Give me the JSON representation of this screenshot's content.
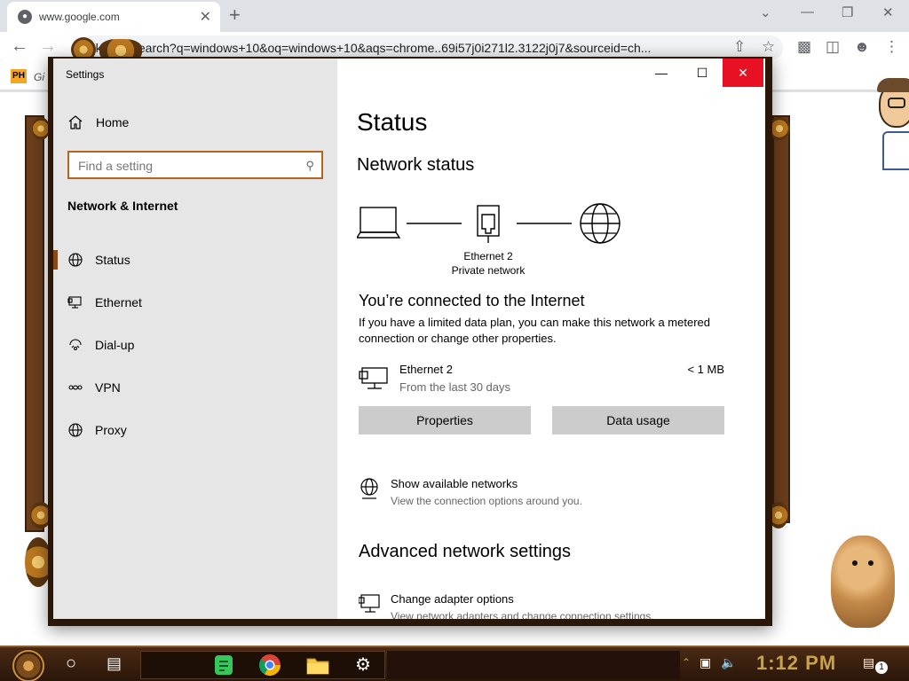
{
  "browser": {
    "tab_title": "www.google.com",
    "url": "...k.com/search?q=windows+10&oq=windows+10&aqs=chrome..69i57j0i271l2.3122j0j7&sourceid=ch...",
    "bookmark_badge": "PH",
    "bookmark_label": "Gi"
  },
  "settings": {
    "window_title": "Settings",
    "home_label": "Home",
    "search_placeholder": "Find a setting",
    "section_title": "Network & Internet",
    "nav": [
      {
        "label": "Status",
        "icon": "status-globe-icon",
        "selected": true
      },
      {
        "label": "Ethernet",
        "icon": "ethernet-icon",
        "selected": false
      },
      {
        "label": "Dial-up",
        "icon": "dial-up-icon",
        "selected": false
      },
      {
        "label": "VPN",
        "icon": "vpn-icon",
        "selected": false
      },
      {
        "label": "Proxy",
        "icon": "proxy-globe-icon",
        "selected": false
      }
    ],
    "page_title": "Status",
    "network_status_heading": "Network status",
    "diagram": {
      "adapter_name": "Ethernet 2",
      "network_type": "Private network"
    },
    "connected_title": "You’re connected to the Internet",
    "connected_desc": "If you have a limited data plan, you can make this network a metered connection or change other properties.",
    "connection": {
      "name": "Ethernet 2",
      "period": "From the last 30 days",
      "usage": "< 1 MB"
    },
    "properties_button": "Properties",
    "data_usage_button": "Data usage",
    "show_networks": {
      "title": "Show available networks",
      "subtitle": "View the connection options around you."
    },
    "advanced_heading": "Advanced network settings",
    "adapter_options": {
      "title": "Change adapter options",
      "subtitle": "View network adapters and change connection settings."
    }
  },
  "taskbar": {
    "clock": "1:12 PM",
    "notification_count": "1"
  },
  "colors": {
    "accent": "#8a4a16",
    "close_red": "#e81123",
    "sidebar_bg": "#e6e6e6",
    "button_gray": "#cccccc",
    "clock_gold": "#c9a24a"
  }
}
